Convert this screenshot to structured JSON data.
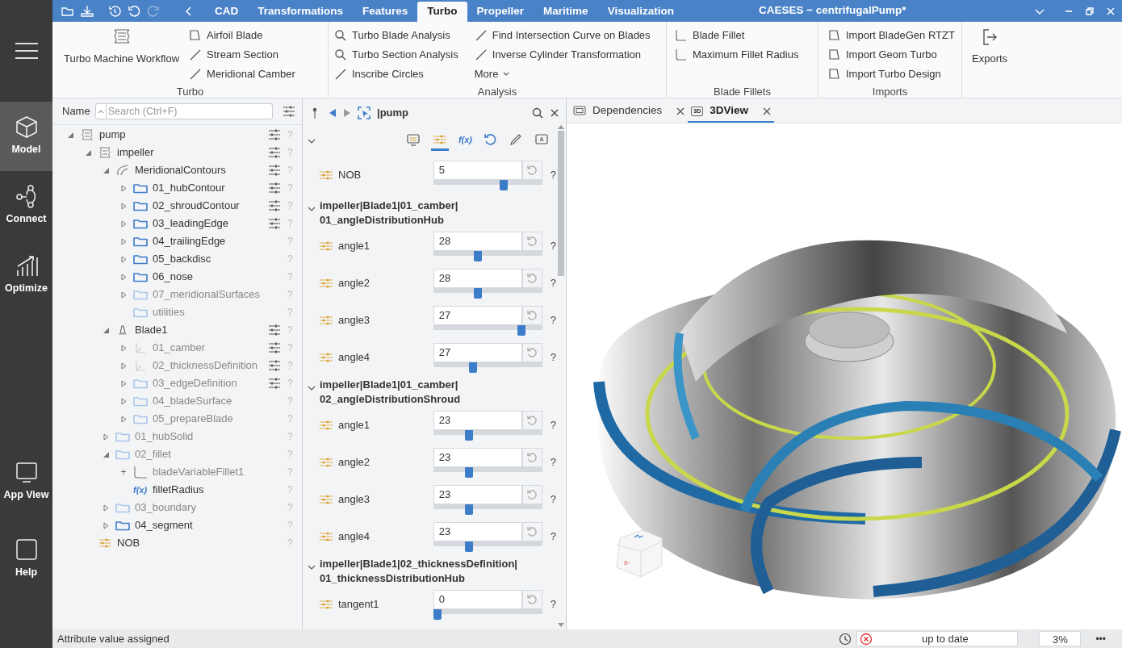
{
  "window": {
    "title": "CAESES − centrifugalPump*"
  },
  "quick_access": [
    {
      "kind": "open",
      "disabled": false
    },
    {
      "kind": "save",
      "disabled": false
    },
    {
      "kind": "history",
      "disabled": false
    },
    {
      "kind": "undo",
      "disabled": false
    },
    {
      "kind": "redo",
      "disabled": true
    },
    {
      "kind": "back",
      "disabled": false
    }
  ],
  "tabs": [
    {
      "label": "CAD",
      "selected": false
    },
    {
      "label": "Transformations",
      "selected": false
    },
    {
      "label": "Features",
      "selected": false
    },
    {
      "label": "Turbo",
      "selected": true
    },
    {
      "label": "Propeller",
      "selected": false
    },
    {
      "label": "Maritime",
      "selected": false
    },
    {
      "label": "Visualization",
      "selected": false
    }
  ],
  "nav": [
    {
      "label": "Model",
      "kind": "cube",
      "selected": true
    },
    {
      "label": "Connect",
      "kind": "connect",
      "selected": false
    },
    {
      "label": "Optimize",
      "kind": "chart",
      "selected": false
    },
    {
      "label": "App View",
      "kind": "app",
      "selected": false
    },
    {
      "label": "Help",
      "kind": "help",
      "selected": false
    }
  ],
  "ribbon": [
    {
      "label": "Turbo",
      "large": [
        {
          "label": "Turbo Machine Workflow",
          "kind": "workflow"
        }
      ],
      "columns": [
        [
          {
            "label": "Airfoil Blade",
            "kind": "airfoil"
          },
          {
            "label": "Stream Section",
            "kind": "line"
          },
          {
            "label": "Meridional Camber",
            "kind": "line"
          }
        ]
      ]
    },
    {
      "label": "Analysis",
      "columns": [
        [
          {
            "label": "Turbo Blade Analysis",
            "kind": "search"
          },
          {
            "label": "Turbo Section Analysis",
            "kind": "search"
          },
          {
            "label": "Inscribe Circles",
            "kind": "line"
          }
        ],
        [
          {
            "label": "Find Intersection Curve on Blades",
            "kind": "line"
          },
          {
            "label": "Inverse Cylinder Transformation",
            "kind": "line"
          },
          {
            "label": "More",
            "kind": "more"
          }
        ]
      ]
    },
    {
      "label": "Blade Fillets",
      "columns": [
        [
          {
            "label": "Blade Fillet",
            "kind": "fillet"
          },
          {
            "label": "Maximum Fillet Radius",
            "kind": "fillet"
          }
        ]
      ]
    },
    {
      "label": "Imports",
      "columns": [
        [
          {
            "label": "Import BladeGen RTZT",
            "kind": "airfoil"
          },
          {
            "label": "Import Geom Turbo",
            "kind": "airfoil"
          },
          {
            "label": "Import Turbo Design",
            "kind": "airfoil"
          }
        ]
      ]
    },
    {
      "large": [
        {
          "label": "Exports",
          "kind": "export"
        }
      ]
    }
  ],
  "tree": {
    "column": "Name",
    "search": {
      "placeholder": "Search (Ctrl+F)"
    },
    "items": [
      {
        "label": "pump",
        "kind": "workflow",
        "expanded": true,
        "dimmed": false,
        "settings": true,
        "help": "?",
        "children": [
          {
            "label": "impeller",
            "kind": "workflow",
            "expanded": true,
            "dimmed": false,
            "settings": true,
            "help": "?",
            "children": [
              {
                "label": "MeridionalContours",
                "kind": "curve",
                "expanded": true,
                "dimmed": false,
                "settings": true,
                "help": "?",
                "children": [
                  {
                    "label": "01_hubContour",
                    "kind": "folder",
                    "expanded": false,
                    "dimmed": false,
                    "settings": true,
                    "help": "?"
                  },
                  {
                    "label": "02_shroudContour",
                    "kind": "folder",
                    "expanded": false,
                    "dimmed": false,
                    "settings": true,
                    "help": "?"
                  },
                  {
                    "label": "03_leadingEdge",
                    "kind": "folder",
                    "expanded": false,
                    "dimmed": false,
                    "settings": true,
                    "help": "?"
                  },
                  {
                    "label": "04_trailingEdge",
                    "kind": "folder",
                    "expanded": false,
                    "dimmed": false,
                    "settings": false,
                    "help": "?"
                  },
                  {
                    "label": "05_backdisc",
                    "kind": "folder",
                    "expanded": false,
                    "dimmed": false,
                    "settings": false,
                    "help": "?"
                  },
                  {
                    "label": "06_nose",
                    "kind": "folder",
                    "expanded": false,
                    "dimmed": false,
                    "settings": false,
                    "help": "?"
                  },
                  {
                    "label": "07_meridionalSurfaces",
                    "kind": "folder",
                    "expanded": false,
                    "dimmed": true,
                    "settings": false,
                    "help": "?"
                  },
                  {
                    "label": "utilities",
                    "kind": "folder",
                    "dimmed": true,
                    "settings": false,
                    "help": "?"
                  }
                ]
              },
              {
                "label": "Blade1",
                "kind": "blade",
                "expanded": true,
                "dimmed": false,
                "settings": true,
                "help": "?",
                "children": [
                  {
                    "label": "01_camber",
                    "kind": "axes",
                    "expanded": false,
                    "dimmed": true,
                    "settings": true,
                    "help": "?"
                  },
                  {
                    "label": "02_thicknessDefinition",
                    "kind": "axes",
                    "expanded": false,
                    "dimmed": true,
                    "settings": true,
                    "help": "?"
                  },
                  {
                    "label": "03_edgeDefinition",
                    "kind": "folder",
                    "expanded": false,
                    "dimmed": true,
                    "settings": true,
                    "help": "?"
                  },
                  {
                    "label": "04_bladeSurface",
                    "kind": "folder",
                    "expanded": false,
                    "dimmed": true,
                    "settings": false,
                    "help": "?"
                  },
                  {
                    "label": "05_prepareBlade",
                    "kind": "folder",
                    "expanded": false,
                    "dimmed": true,
                    "settings": false,
                    "help": "?"
                  }
                ]
              },
              {
                "label": "01_hubSolid",
                "kind": "folder",
                "expanded": false,
                "dimmed": true,
                "settings": false,
                "help": "?"
              },
              {
                "label": "02_fillet",
                "kind": "folder",
                "expanded": true,
                "dimmed": true,
                "settings": false,
                "help": "?",
                "children": [
                  {
                    "label": "bladeVariableFillet1",
                    "kind": "fillet",
                    "marker": "+",
                    "dimmed": true,
                    "settings": false,
                    "help": "?"
                  },
                  {
                    "label": "filletRadius",
                    "kind": "function",
                    "icon_text": "f(x)",
                    "dimmed": false,
                    "settings": false,
                    "help": "?"
                  }
                ]
              },
              {
                "label": "03_boundary",
                "kind": "folder",
                "expanded": false,
                "dimmed": true,
                "settings": false,
                "help": "?"
              },
              {
                "label": "04_segment",
                "kind": "folder",
                "expanded": false,
                "dimmed": false,
                "settings": false,
                "help": "?"
              }
            ]
          },
          {
            "label": "NOB",
            "kind": "parameter",
            "dimmed": false,
            "settings": false,
            "help": "?"
          }
        ]
      }
    ]
  },
  "properties": {
    "path": "|pump",
    "view_buttons": [
      {
        "kind": "display",
        "selected": false
      },
      {
        "kind": "parameters",
        "selected": true
      },
      {
        "kind": "function",
        "label": "f(x)",
        "selected": false
      },
      {
        "kind": "reset",
        "selected": false
      },
      {
        "kind": "edit",
        "selected": false
      },
      {
        "kind": "app",
        "selected": false
      }
    ],
    "items": [
      {
        "name": "NOB",
        "value": "5",
        "level": 0.66,
        "help": "?"
      }
    ],
    "sections": [
      {
        "title": "impeller|Blade1|01_camber|\n01_angleDistributionHub",
        "params": [
          {
            "name": "angle1",
            "value": "28",
            "level": 0.4,
            "help": "?"
          },
          {
            "name": "angle2",
            "value": "28",
            "level": 0.4,
            "help": "?"
          },
          {
            "name": "angle3",
            "value": "27",
            "level": 0.83,
            "help": "?"
          },
          {
            "name": "angle4",
            "value": "27",
            "level": 0.35,
            "help": "?"
          }
        ]
      },
      {
        "title": "impeller|Blade1|01_camber|\n02_angleDistributionShroud",
        "params": [
          {
            "name": "angle1",
            "value": "23",
            "level": 0.31,
            "help": "?"
          },
          {
            "name": "angle2",
            "value": "23",
            "level": 0.31,
            "help": "?"
          },
          {
            "name": "angle3",
            "value": "23",
            "level": 0.31,
            "help": "?"
          },
          {
            "name": "angle4",
            "value": "23",
            "level": 0.31,
            "help": "?"
          }
        ]
      },
      {
        "title": "impeller|Blade1|02_thicknessDefinition|\n01_thicknessDistributionHub",
        "params": [
          {
            "name": "tangent1",
            "value": "0",
            "level": 0,
            "help": "?"
          }
        ]
      }
    ]
  },
  "doc_tabs": [
    {
      "label": "Dependencies",
      "kind": "screen",
      "selected": false
    },
    {
      "label": "3DView",
      "kind": "viewer",
      "icon_text": "3D",
      "selected": true
    }
  ],
  "view_cube": {
    "label": "x-"
  },
  "status_bar": {
    "message": "Attribute value assigned",
    "state": "up to date",
    "progress": "3%",
    "more": "•••"
  }
}
